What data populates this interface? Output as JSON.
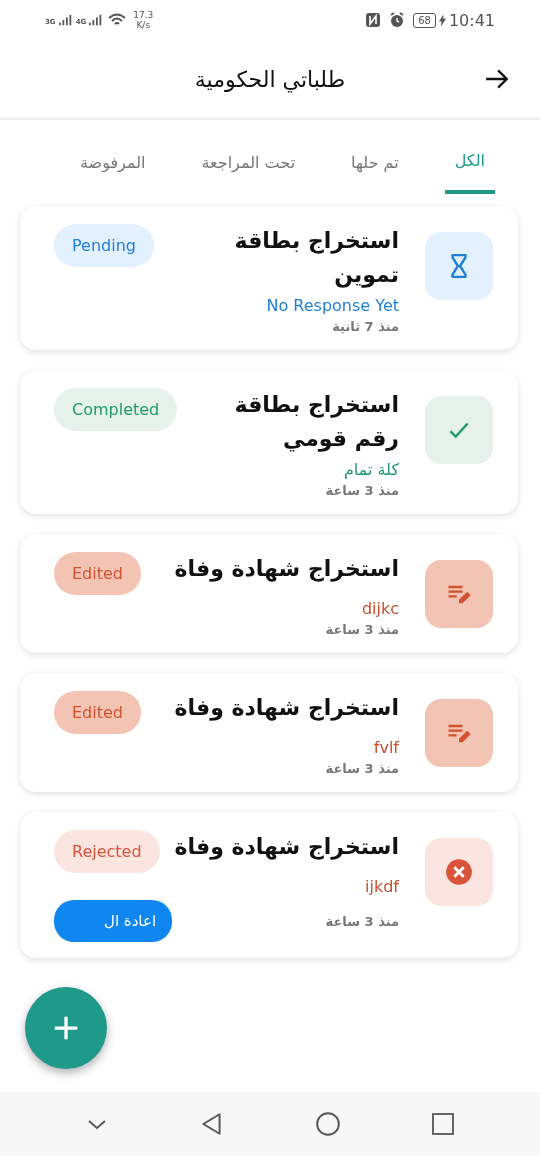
{
  "status_bar": {
    "network_1": "3G",
    "network_2": "4G",
    "speed": "17.3",
    "speed_unit": "K/s",
    "battery": "68",
    "time": "10:41"
  },
  "header": {
    "title": "طلباتي الحكومية"
  },
  "tabs": [
    {
      "label": "الكل",
      "selected": true
    },
    {
      "label": "تم حلها",
      "selected": false
    },
    {
      "label": "تحت المراجعة",
      "selected": false
    },
    {
      "label": "المرفوضة",
      "selected": false
    }
  ],
  "requests": [
    {
      "kind": "pending",
      "title": "استخراج بطاقة تموين",
      "status": "Pending",
      "note": "No Response Yet",
      "time": "منذ 7 ثانية"
    },
    {
      "kind": "completed",
      "title": "استخراج بطاقة رقم قومي",
      "status": "Completed",
      "note": "كلة تمام",
      "time": "منذ 3 ساعة"
    },
    {
      "kind": "edited",
      "title": "استخراج شهادة وفاة",
      "status": "Edited",
      "note": "dijkc",
      "time": "منذ 3 ساعة"
    },
    {
      "kind": "edited",
      "title": "استخراج شهادة وفاة",
      "status": "Edited",
      "note": "fvlf",
      "time": "منذ 3 ساعة"
    },
    {
      "kind": "rejected",
      "title": "استخراج شهادة وفاة",
      "status": "Rejected",
      "note": "ijkdf",
      "time": "منذ 3 ساعة",
      "action": "اعادة ال"
    }
  ]
}
